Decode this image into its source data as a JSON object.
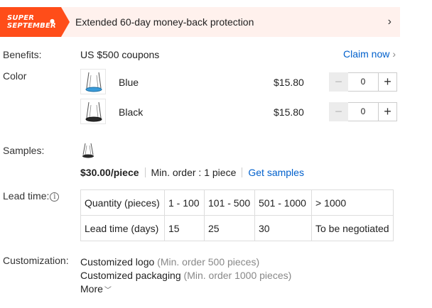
{
  "banner": {
    "badge_line1": "SUPER",
    "badge_line2": "SEPTEMBER",
    "text": "Extended 60-day money-back protection",
    "chevron": "›"
  },
  "benefits": {
    "label": "Benefits:",
    "value": "US $500 coupons",
    "claim_label": "Claim now"
  },
  "color": {
    "label": "Color",
    "variants": [
      {
        "name": "Blue",
        "price": "$15.80",
        "quantity": "0",
        "thumb_icon": "swing-blue-icon",
        "accent": "#3a9bd9"
      },
      {
        "name": "Black",
        "price": "$15.80",
        "quantity": "0",
        "thumb_icon": "swing-black-icon",
        "accent": "#222222"
      }
    ]
  },
  "samples": {
    "label": "Samples:",
    "price": "$30.00/piece",
    "min_order": "Min. order : 1 piece",
    "link": "Get samples"
  },
  "lead_time": {
    "label": "Lead time:",
    "info_icon": "i",
    "header": [
      "Quantity (pieces)",
      "1 - 100",
      "101 - 500",
      "501 - 1000",
      "> 1000"
    ],
    "row": [
      "Lead time (days)",
      "15",
      "25",
      "30",
      "To be negotiated"
    ]
  },
  "customization": {
    "label": "Customization:",
    "items": [
      {
        "name": "Customized logo",
        "note": "(Min. order 500 pieces)"
      },
      {
        "name": "Customized packaging",
        "note": "(Min. order 1000 pieces)"
      }
    ],
    "more_label": "More"
  },
  "colors": {
    "brand": "#ff4d19",
    "banner_bg": "#fff1ed",
    "link": "#0060cc"
  }
}
